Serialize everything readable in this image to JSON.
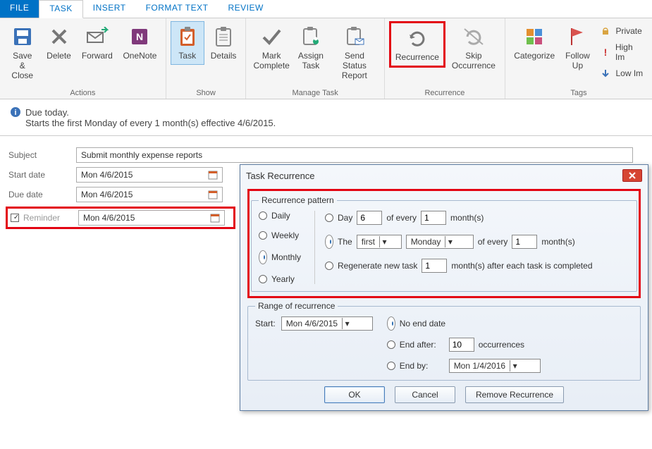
{
  "tabs": {
    "file": "FILE",
    "task": "TASK",
    "insert": "INSERT",
    "format": "FORMAT TEXT",
    "review": "REVIEW"
  },
  "ribbon": {
    "actions": {
      "label": "Actions",
      "save_close": "Save &\nClose",
      "delete": "Delete",
      "forward": "Forward",
      "onenote": "OneNote"
    },
    "show": {
      "label": "Show",
      "task": "Task",
      "details": "Details"
    },
    "manage": {
      "label": "Manage Task",
      "mark": "Mark\nComplete",
      "assign": "Assign\nTask",
      "send": "Send Status\nReport"
    },
    "recur": {
      "label": "Recurrence",
      "recurrence": "Recurrence",
      "skip": "Skip\nOccurrence"
    },
    "tags": {
      "label": "Tags",
      "categorize": "Categorize",
      "followup": "Follow\nUp",
      "private": "Private",
      "high": "High Im",
      "low": "Low Im"
    }
  },
  "info": {
    "line1": "Due today.",
    "line2": "Starts the first Monday of every 1 month(s) effective 4/6/2015."
  },
  "form": {
    "subject_label": "Subject",
    "subject_value": "Submit monthly expense reports",
    "start_label": "Start date",
    "start_value": "Mon 4/6/2015",
    "due_label": "Due date",
    "due_value": "Mon 4/6/2015",
    "reminder_label": "Reminder",
    "reminder_value": "Mon 4/6/2015"
  },
  "dialog": {
    "title": "Task Recurrence",
    "pattern_legend": "Recurrence pattern",
    "daily": "Daily",
    "weekly": "Weekly",
    "monthly": "Monthly",
    "yearly": "Yearly",
    "opt_day": "Day",
    "opt_day_n": "6",
    "opt_day_of": "of every",
    "opt_day_m": "1",
    "opt_day_suffix": "month(s)",
    "opt_the": "The",
    "opt_the_ord": "first",
    "opt_the_dow": "Monday",
    "opt_the_of": "of every",
    "opt_the_m": "1",
    "opt_the_suffix": "month(s)",
    "opt_regen": "Regenerate new task",
    "opt_regen_n": "1",
    "opt_regen_suffix": "month(s) after each task is completed",
    "range_legend": "Range of recurrence",
    "range_start": "Start:",
    "range_start_val": "Mon 4/6/2015",
    "range_noend": "No end date",
    "range_endafter": "End after:",
    "range_endafter_n": "10",
    "range_endafter_suffix": "occurrences",
    "range_endby": "End by:",
    "range_endby_val": "Mon 1/4/2016",
    "ok": "OK",
    "cancel": "Cancel",
    "remove": "Remove Recurrence"
  }
}
